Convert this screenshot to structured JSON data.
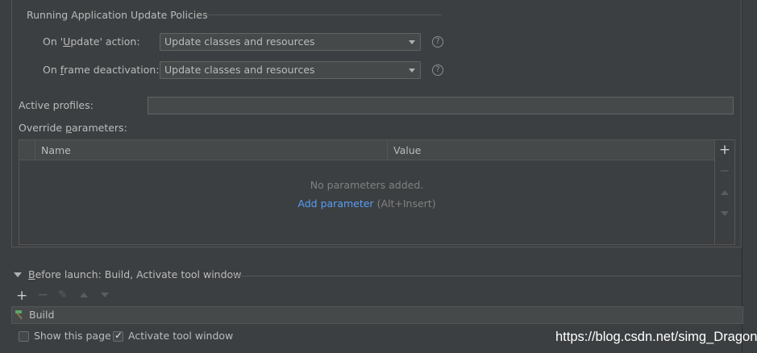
{
  "update_policies": {
    "group_title": "Running Application Update Policies",
    "on_update": {
      "label_prefix": "On '",
      "label_underlined": "U",
      "label_suffix": "pdate' action:",
      "value": "Update classes and resources"
    },
    "on_frame_deactivation": {
      "label_prefix": "On ",
      "label_underlined": "f",
      "label_suffix": "rame deactivation:",
      "value": "Update classes and resources"
    },
    "help_symbol": "?"
  },
  "active_profiles": {
    "label": "Active profiles:",
    "value": ""
  },
  "override_parameters": {
    "label_prefix": "Override ",
    "label_underlined": "p",
    "label_suffix": "arameters:",
    "columns": [
      "Name",
      "Value"
    ],
    "empty_text": "No parameters added.",
    "add_link": "Add parameter",
    "add_shortcut": "(Alt+Insert)",
    "toolbar_icons": [
      "plus-icon",
      "minus-icon",
      "arrow-up-icon",
      "arrow-down-icon"
    ]
  },
  "before_launch": {
    "title_underlined": "B",
    "title_rest": "efore launch: Build, Activate tool window",
    "toolbar_icons": [
      "plus-icon",
      "minus-icon",
      "pencil-icon",
      "arrow-up-icon",
      "arrow-down-icon"
    ],
    "tasks": [
      {
        "label": "Build",
        "icon": "hammer-icon"
      }
    ]
  },
  "options": {
    "show_this_page": {
      "label": "Show this page",
      "checked": false
    },
    "activate_tool_window": {
      "label": "Activate tool window",
      "checked": true
    }
  },
  "watermark": "https://blog.csdn.net/simg_Dragon",
  "colors": {
    "background": "#3c3f41",
    "field_background": "#45494a",
    "border": "#555555",
    "link": "#589df6",
    "text": "#bbbbbb",
    "muted_text": "#808080",
    "hammer_green": "#59a869"
  }
}
